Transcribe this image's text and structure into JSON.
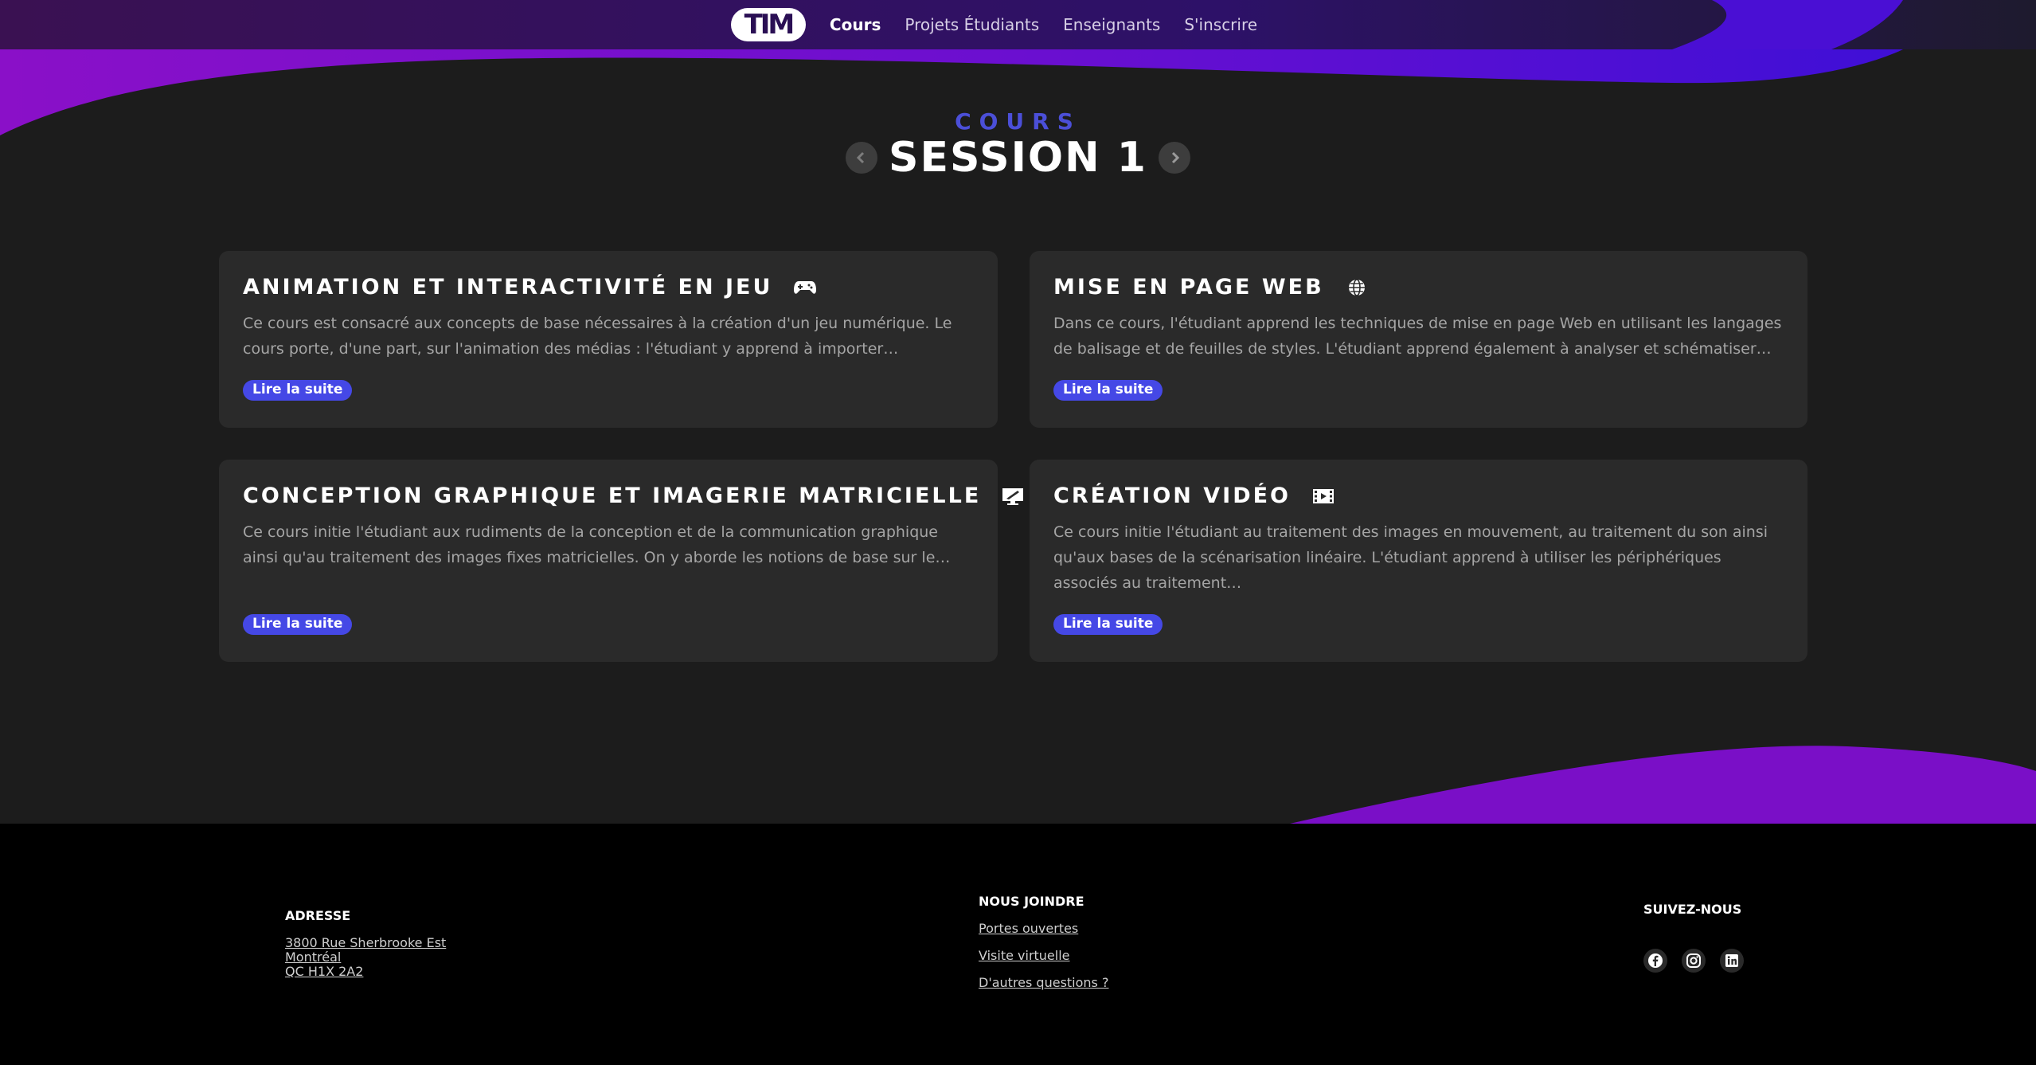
{
  "nav": {
    "logo": "TIM",
    "links": [
      "Cours",
      "Projets Étudiants",
      "Enseignants",
      "S'inscrire"
    ]
  },
  "header": {
    "eyebrow": "COURS",
    "title": "SESSION 1"
  },
  "courses": [
    {
      "title": "ANIMATION ET INTERACTIVITÉ EN JEU",
      "icon": "gamepad-icon",
      "description": "Ce cours est consacré aux concepts de base nécessaires à la création d'un jeu numérique. Le cours porte, d'une part, sur l'animation des médias : l'étudiant y apprend à importer…",
      "button": "Lire la suite"
    },
    {
      "title": "MISE EN PAGE WEB",
      "icon": "globe-icon",
      "description": "Dans ce cours, l'étudiant apprend les techniques de mise en page Web en utilisant les langages de balisage et de feuilles de styles. L'étudiant apprend également à analyser et schématiser…",
      "button": "Lire la suite"
    },
    {
      "title": "CONCEPTION GRAPHIQUE ET IMAGERIE MATRICIELLE",
      "icon": "monitor-brush-icon",
      "description": "Ce cours initie l'étudiant aux rudiments de la conception et de la communication graphique ainsi qu'au traitement des images fixes matricielles. On y aborde les notions de base sur le…",
      "button": "Lire la suite"
    },
    {
      "title": "CRÉATION VIDÉO",
      "icon": "film-icon",
      "description": "Ce cours initie l'étudiant au traitement des images en mouvement, au traitement du son ainsi qu'aux bases de la scénarisation linéaire. L'étudiant apprend à utiliser les périphériques associés au traitement…",
      "button": "Lire la suite"
    }
  ],
  "footer": {
    "address": {
      "heading": "ADRESSE",
      "line1": "3800 Rue Sherbrooke Est",
      "line2": "Montréal",
      "line3": "QC H1X 2A2"
    },
    "contact": {
      "heading": "NOUS JOINDRE",
      "links": [
        "Portes ouvertes",
        "Visite virtuelle",
        "D'autres questions ?"
      ]
    },
    "social": {
      "heading": "SUIVEZ-NOUS",
      "icons": [
        "facebook-icon",
        "instagram-icon",
        "linkedin-icon"
      ]
    }
  },
  "colors": {
    "accent": "#4548e6",
    "purple": "#7a0fc7",
    "background": "#1c1c1c",
    "card": "#2a2a2a"
  }
}
